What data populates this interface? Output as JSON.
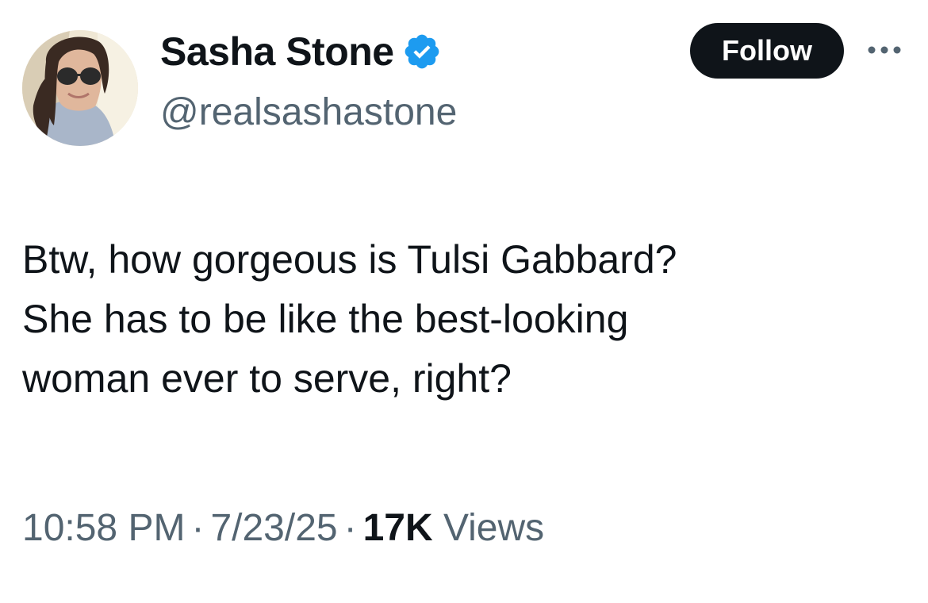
{
  "author": {
    "display_name": "Sasha Stone",
    "handle": "@realsashastone",
    "verified": true,
    "verified_color": "#1d9bf0"
  },
  "actions": {
    "follow_label": "Follow",
    "more_icon": "more-horizontal-icon"
  },
  "tweet": {
    "lines": [
      "Btw, how gorgeous is Tulsi Gabbard?",
      "She has to be like the best-looking",
      "woman ever to serve, right?"
    ]
  },
  "meta": {
    "time": "10:58 PM",
    "separator": "·",
    "date": "7/23/25",
    "views_count": "17K",
    "views_label": "Views"
  },
  "colors": {
    "text_primary": "#0f1419",
    "text_secondary": "#536471",
    "button_bg": "#0f1419",
    "button_text": "#ffffff"
  }
}
